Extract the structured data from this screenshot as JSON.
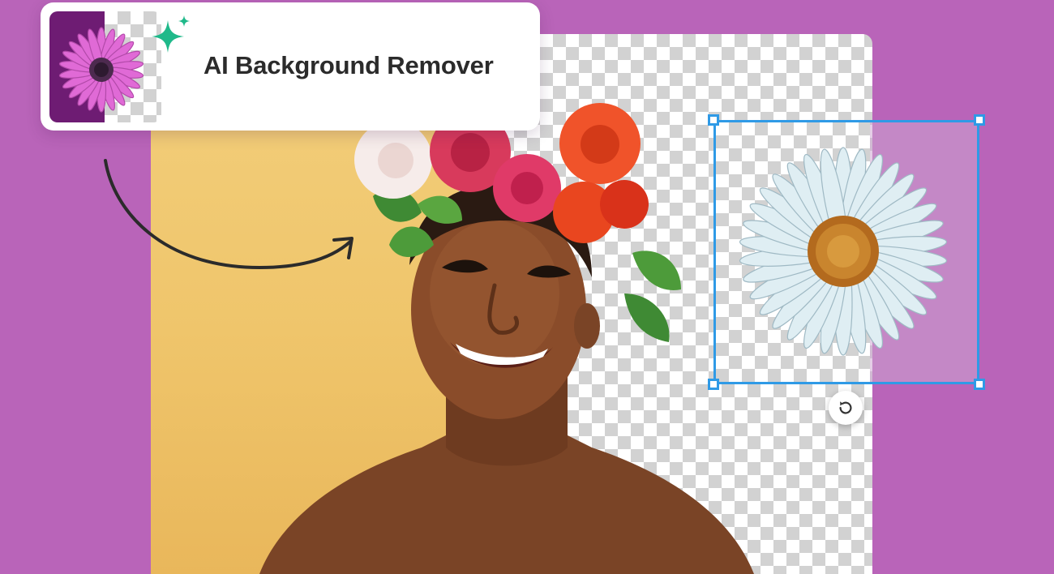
{
  "header": {
    "title": "AI Background Remover",
    "thumbnail_icon": "purple-daisy-thumbnail",
    "sparkle_icon": "ai-sparkle-icon",
    "accent_color": "#1fb98a"
  },
  "canvas": {
    "background_color": "#b964b9",
    "selection_color": "#2f9ae6"
  },
  "controls": {
    "rotate_icon": "rotate-icon"
  }
}
